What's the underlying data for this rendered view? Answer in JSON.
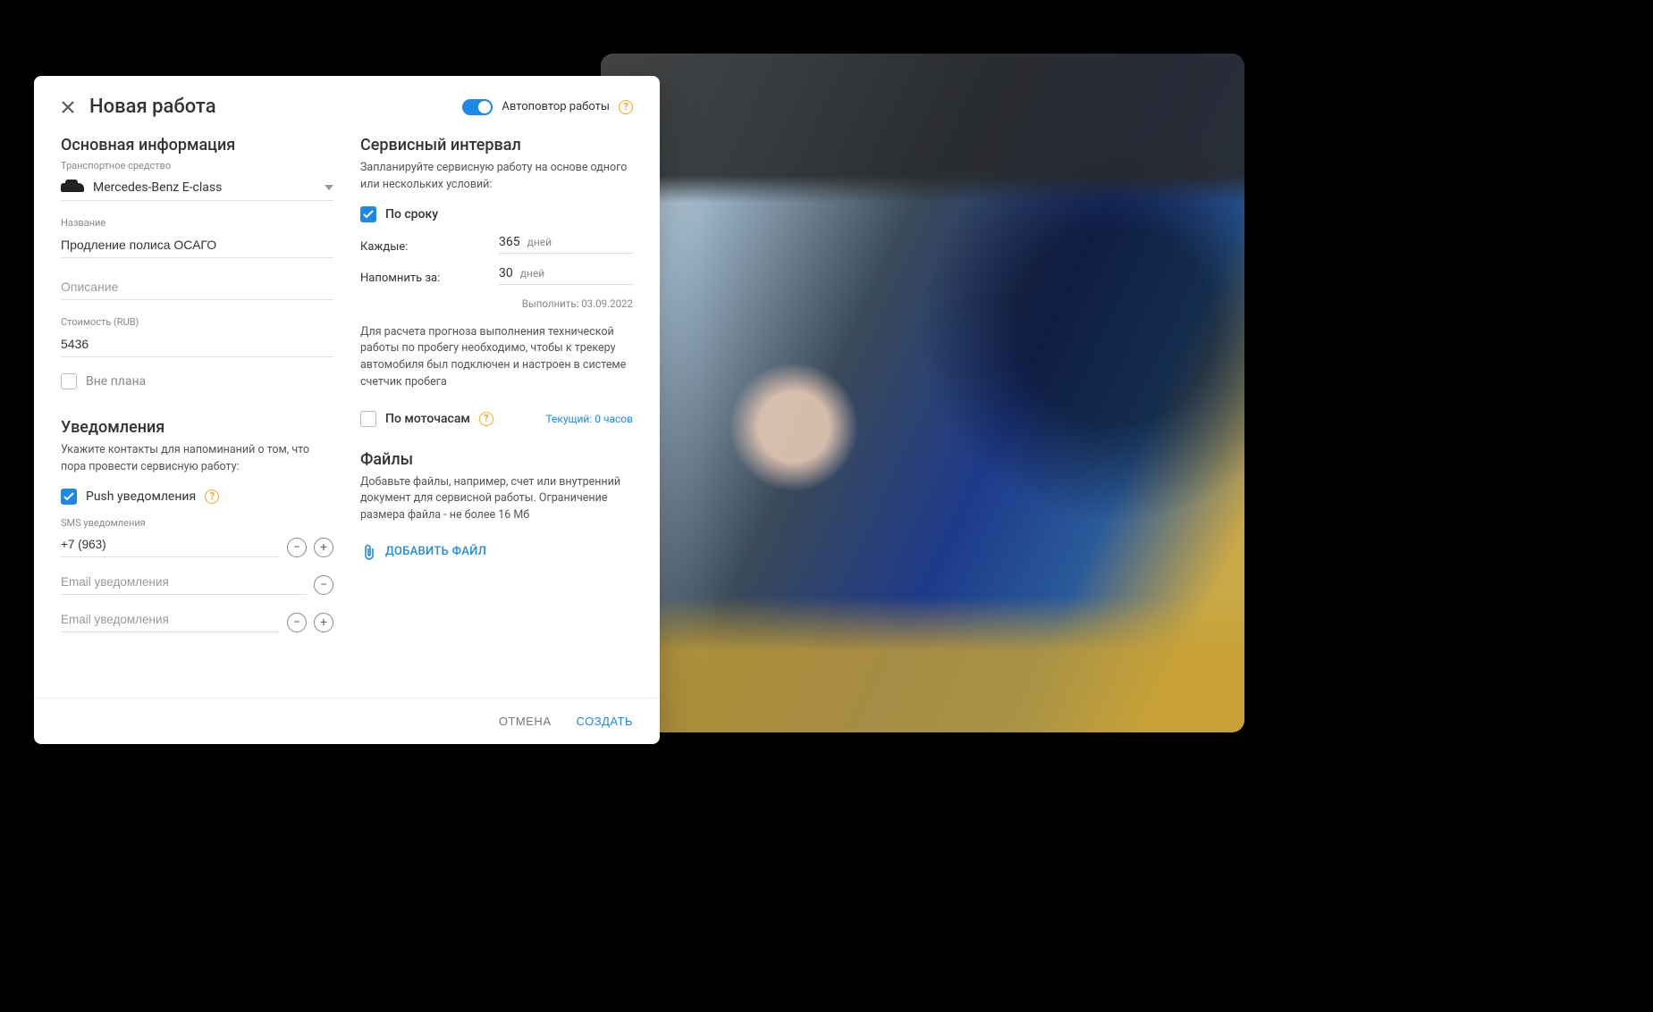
{
  "modal": {
    "title": "Новая работа",
    "autorepeat_label": "Автоповтор работы",
    "cancel": "ОТМЕНА",
    "submit": "СОЗДАТЬ"
  },
  "basic": {
    "heading": "Основная информация",
    "vehicle_label": "Транспортное средство",
    "vehicle_value": "Mercedes-Benz E-class",
    "name_label": "Название",
    "name_value": "Продление полиса ОСАГО",
    "description_placeholder": "Описание",
    "description_value": "",
    "cost_label": "Стоимость (RUB)",
    "cost_value": "5436",
    "unplanned_label": "Вне плана"
  },
  "notifications": {
    "heading": "Уведомления",
    "desc": "Укажите контакты для напоминаний о том, что пора провести сервисную работу:",
    "push_label": "Push уведомления",
    "sms_label": "SMS уведомления",
    "sms_value": "+7 (963)",
    "email_placeholder": "Email уведомления",
    "email1_value": "",
    "email2_value": ""
  },
  "interval": {
    "heading": "Сервисный интервал",
    "desc": "Запланируйте сервисную работу на основе одного или нескольких условий:",
    "by_term_label": "По сроку",
    "every_label": "Каждые:",
    "every_value": "365",
    "every_unit": "дней",
    "remind_label": "Напомнить за:",
    "remind_value": "30",
    "remind_unit": "дней",
    "due_text": "Выполнить: 03.09.2022",
    "mileage_note": "Для расчета прогноза выполнения технической работы по пробегу необходимо, чтобы к трекеру автомобиля был подключен и настроен в системе счетчик пробега",
    "by_motorhours_label": "По моточасам",
    "current_text": "Текущий: 0 часов"
  },
  "files": {
    "heading": "Файлы",
    "desc": "Добавьте файлы, например, счет или внутренний документ для сервисной работы. Ограничение размера файла - не более 16 Мб",
    "add_label": "ДОБАВИТЬ ФАЙЛ"
  }
}
